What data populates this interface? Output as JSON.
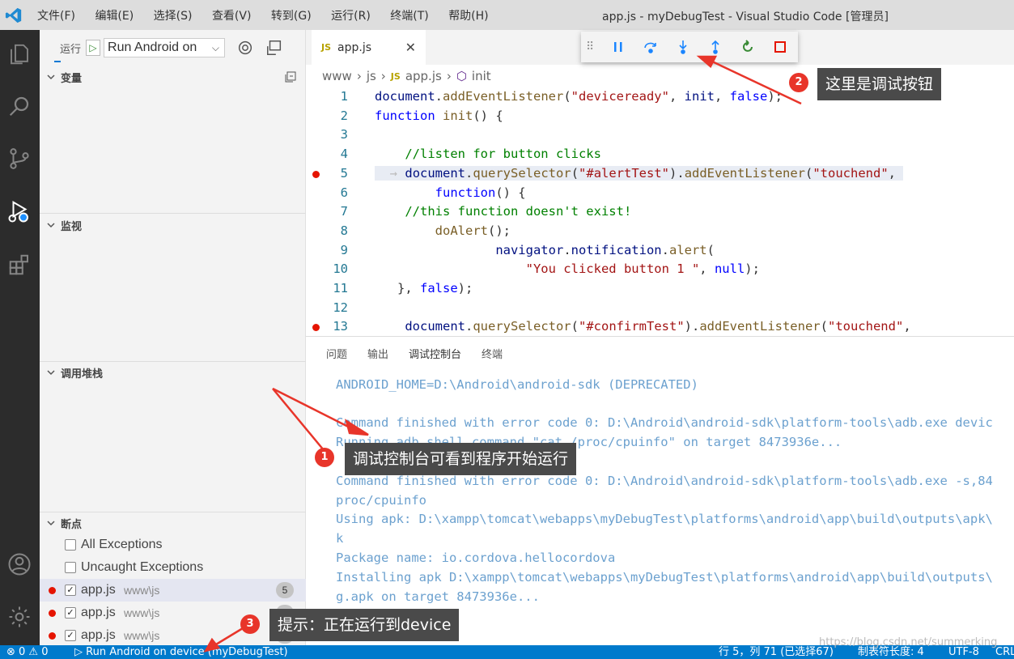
{
  "titlebar": {
    "menu": [
      "文件(F)",
      "编辑(E)",
      "选择(S)",
      "查看(V)",
      "转到(G)",
      "运行(R)",
      "终端(T)",
      "帮助(H)"
    ],
    "title": "app.js - myDebugTest - Visual Studio Code [管理员]"
  },
  "activity_bar": {
    "icons": [
      "files-icon",
      "search-icon",
      "source-control-icon",
      "run-debug-icon",
      "extensions-icon",
      "account-icon",
      "settings-gear-icon"
    ]
  },
  "sidebar": {
    "run_label": "运行",
    "config_label": "Run Android on",
    "sections": {
      "variables": "变量",
      "watch": "监视",
      "callstack": "调用堆栈",
      "breakpoints": "断点"
    },
    "breakpoints": [
      {
        "name": "All Exceptions",
        "checked": false
      },
      {
        "name": "Uncaught Exceptions",
        "checked": false
      },
      {
        "name": "app.js",
        "path": "www\\js",
        "count": "5",
        "checked": true
      },
      {
        "name": "app.js",
        "path": "www\\js",
        "count": "13",
        "checked": true
      },
      {
        "name": "app.js",
        "path": "www\\js",
        "count": "27",
        "checked": true
      }
    ]
  },
  "editor": {
    "tab": {
      "icon": "JS",
      "name": "app.js"
    },
    "breadcrumb": [
      "www",
      "js",
      "app.js",
      "init"
    ],
    "lines": [
      {
        "n": "1",
        "bp": false
      },
      {
        "n": "2",
        "bp": false
      },
      {
        "n": "3",
        "bp": false
      },
      {
        "n": "4",
        "bp": false
      },
      {
        "n": "5",
        "bp": true
      },
      {
        "n": "6",
        "bp": false
      },
      {
        "n": "7",
        "bp": false
      },
      {
        "n": "8",
        "bp": false
      },
      {
        "n": "9",
        "bp": false
      },
      {
        "n": "10",
        "bp": false
      },
      {
        "n": "11",
        "bp": false
      },
      {
        "n": "12",
        "bp": false
      },
      {
        "n": "13",
        "bp": true
      }
    ]
  },
  "debug_toolbar": {
    "buttons": [
      "pause-icon",
      "step-over-icon",
      "step-into-icon",
      "step-out-icon",
      "restart-icon",
      "stop-icon"
    ]
  },
  "panel": {
    "tabs": [
      "问题",
      "输出",
      "调试控制台",
      "终端"
    ],
    "active_tab": "调试控制台",
    "console": [
      "ANDROID_HOME=D:\\Android\\android-sdk (DEPRECATED)",
      "",
      "Command finished with error code 0: D:\\Android\\android-sdk\\platform-tools\\adb.exe devic",
      "Running adb shell command \"cat /proc/cpuinfo\" on target 8473936e...",
      "",
      "Command finished with error code 0: D:\\Android\\android-sdk\\platform-tools\\adb.exe -s,84",
      "proc/cpuinfo",
      "Using apk: D:\\xampp\\tomcat\\webapps\\myDebugTest\\platforms\\android\\app\\build\\outputs\\apk\\",
      "k",
      "Package name: io.cordova.hellocordova",
      "Installing apk D:\\xampp\\tomcat\\webapps\\myDebugTest\\platforms\\android\\app\\build\\outputs\\",
      "g.apk on target 8473936e..."
    ]
  },
  "statusbar": {
    "errors": "⊗ 0 ⚠ 0",
    "run": "▷ Run Android on device (myDebugTest)",
    "position": "行 5，列 71 (已选择67)",
    "indent": "制表符长度: 4",
    "encoding": "UTF-8",
    "eol": "CRL"
  },
  "annotations": [
    {
      "num": "1",
      "text": "调试控制台可看到程序开始运行"
    },
    {
      "num": "2",
      "text": "这里是调试按钮"
    },
    {
      "num": "3",
      "text": "提示：正在运行到device"
    }
  ],
  "watermark": "https://blog.csdn.net/summerking",
  "colors": {
    "statusbar": "#007acc",
    "activity": "#2c2c2c",
    "breakpoint": "#e51400",
    "callout_badge": "#e8352a"
  }
}
